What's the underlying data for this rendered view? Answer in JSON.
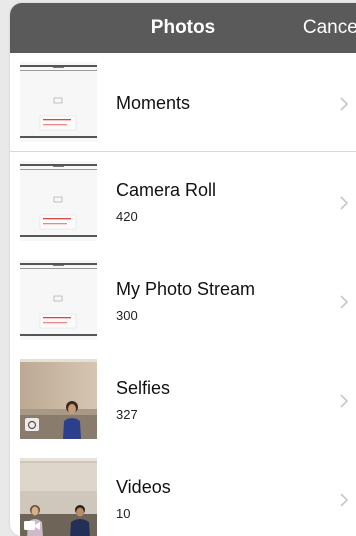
{
  "navbar": {
    "title": "Photos",
    "cancel_label": "Cancel"
  },
  "albums": [
    {
      "title": "Moments",
      "count": ""
    },
    {
      "title": "Camera Roll",
      "count": "420"
    },
    {
      "title": "My Photo Stream",
      "count": "300"
    },
    {
      "title": "Selfies",
      "count": "327"
    },
    {
      "title": "Videos",
      "count": "10"
    }
  ],
  "icons": {
    "chevron": "chevron-right-icon",
    "selfie_badge": "selfie-camera-icon",
    "video_badge": "video-camera-icon"
  },
  "colors": {
    "navbar": "#5a5a5a",
    "chevron": "#c7c7cc"
  }
}
